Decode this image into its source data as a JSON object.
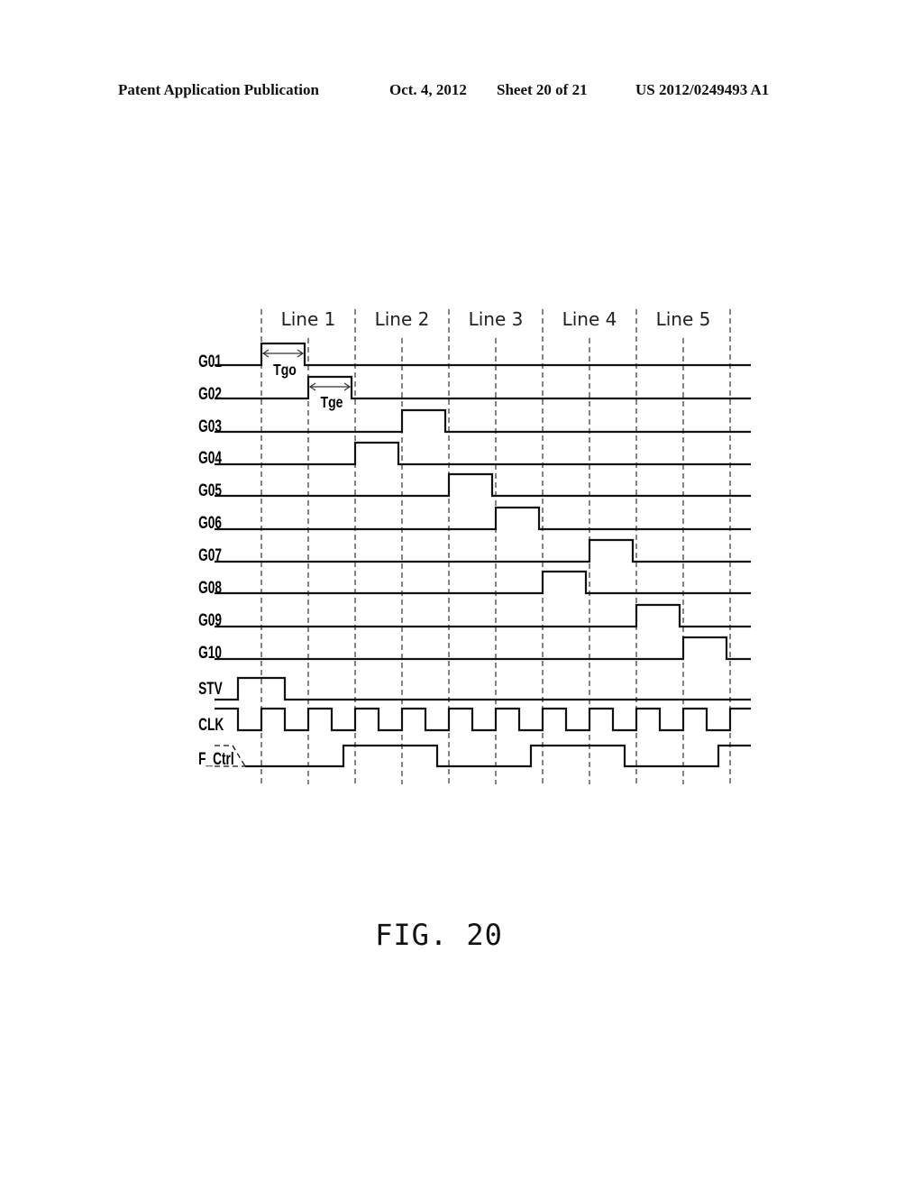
{
  "header": {
    "publication": "Patent Application Publication",
    "date": "Oct. 4, 2012",
    "sheet": "Sheet 20 of 21",
    "number": "US 2012/0249493 A1"
  },
  "figure": {
    "caption": "FIG. 20",
    "line_labels": [
      "Line 1",
      "Line 2",
      "Line 3",
      "Line 4",
      "Line 5"
    ],
    "annotations": {
      "tgo": "Tgo",
      "tge": "Tge"
    },
    "time_unit": "half clock period",
    "signals": [
      {
        "name": "G01",
        "pulses": [
          [
            1,
            2
          ]
        ]
      },
      {
        "name": "G02",
        "pulses": [
          [
            2,
            3
          ]
        ]
      },
      {
        "name": "G03",
        "pulses": [
          [
            4,
            5
          ]
        ]
      },
      {
        "name": "G04",
        "pulses": [
          [
            3,
            4
          ]
        ]
      },
      {
        "name": "G05",
        "pulses": [
          [
            5,
            6
          ]
        ]
      },
      {
        "name": "G06",
        "pulses": [
          [
            6,
            7
          ]
        ]
      },
      {
        "name": "G07",
        "pulses": [
          [
            8,
            9
          ]
        ]
      },
      {
        "name": "G08",
        "pulses": [
          [
            7,
            8
          ]
        ]
      },
      {
        "name": "G09",
        "pulses": [
          [
            9,
            10
          ]
        ]
      },
      {
        "name": "G10",
        "pulses": [
          [
            10,
            11
          ]
        ]
      },
      {
        "name": "STV",
        "pulses": [
          [
            0.5,
            1.5
          ]
        ]
      },
      {
        "name": "CLK",
        "type": "clock",
        "start_high": true,
        "first_fall": 0.5,
        "half_period": 0.5
      },
      {
        "name": "F_Ctrl",
        "type": "control",
        "initial_dashed": true,
        "high_intervals": [
          [
            2.75,
            4.75
          ],
          [
            6.75,
            8.75
          ],
          [
            10.75,
            12
          ]
        ]
      }
    ]
  }
}
